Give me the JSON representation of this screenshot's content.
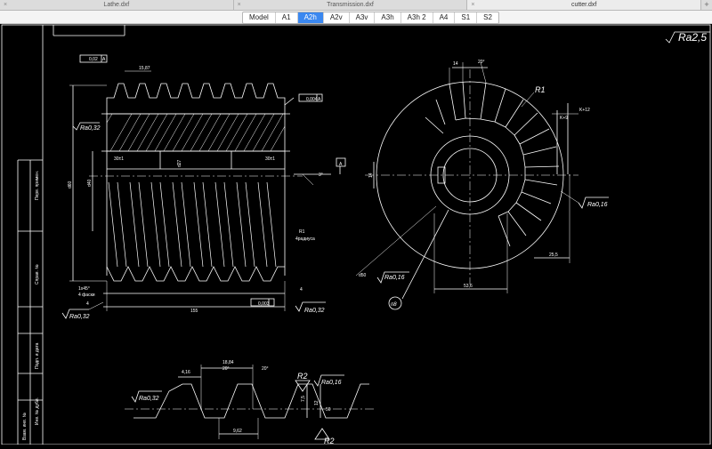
{
  "tabs": [
    {
      "label": "Lathe.dxf",
      "active": false
    },
    {
      "label": "Transmission.dxf",
      "active": false
    },
    {
      "label": "cutter.dxf",
      "active": true
    }
  ],
  "layouts": [
    "Model",
    "A1",
    "A2h",
    "A2v",
    "A3v",
    "A3h",
    "A3h 2",
    "A4",
    "S1",
    "S2"
  ],
  "active_layout": "A2h",
  "drawing": {
    "roughness_main": "Ra2,5",
    "hob": {
      "tol_runout_top": "0,02",
      "tol_runout_right": "0,004",
      "datum": "A",
      "pitch_top": "15,87",
      "ra_left": "Ra0,32",
      "dim_d60": "d60",
      "dim_d40": "d40",
      "dim_d27": "d27",
      "dim_30z1_left": "30±1",
      "dim_30z1_right": "30±1",
      "angle": "3°",
      "radius_note": "R1",
      "radius_note2": "4радиуса",
      "chamfer": "1x45°",
      "chamfer2": "4 фаски",
      "dim_4_left": "4",
      "dim_4_right": "4",
      "overall_length": "155",
      "tol_bottom": "0,003",
      "ra_bottom_left": "Ra0,32",
      "ra_bottom_right": "Ra0,32"
    },
    "gear": {
      "dim_14": "14",
      "angle_20": "20°",
      "radius": "R1",
      "k12": "K+12",
      "k9": "K+9",
      "dim_14_left": "14",
      "ra_right": "Ra0,16",
      "dim_25_5": "25,5",
      "d50": "d50",
      "ra_bore": "Ra0,16",
      "bore": "53,6",
      "callout": "п8"
    },
    "profile": {
      "dim_4_16": "4,16",
      "dim_18_84": "18,84",
      "angle_a": "20°",
      "angle_b": "20°",
      "ra_left": "Ra0,32",
      "r2_top": "R2",
      "r2_bottom": "R2",
      "ra_right": "Ra0,16",
      "dim_7_5": "7,5",
      "dim_12": "12",
      "dim_9_62": "9,62",
      "dim_5": "50"
    },
    "titleblock_labels": [
      "Перв. примен.",
      "Справ. №",
      "Подп. и дата",
      "Инв. № дубл.",
      "Взам. инв. №"
    ]
  },
  "colors": {
    "background": "#000000",
    "lines": "#ffffff",
    "accent": "#3b88f0"
  }
}
